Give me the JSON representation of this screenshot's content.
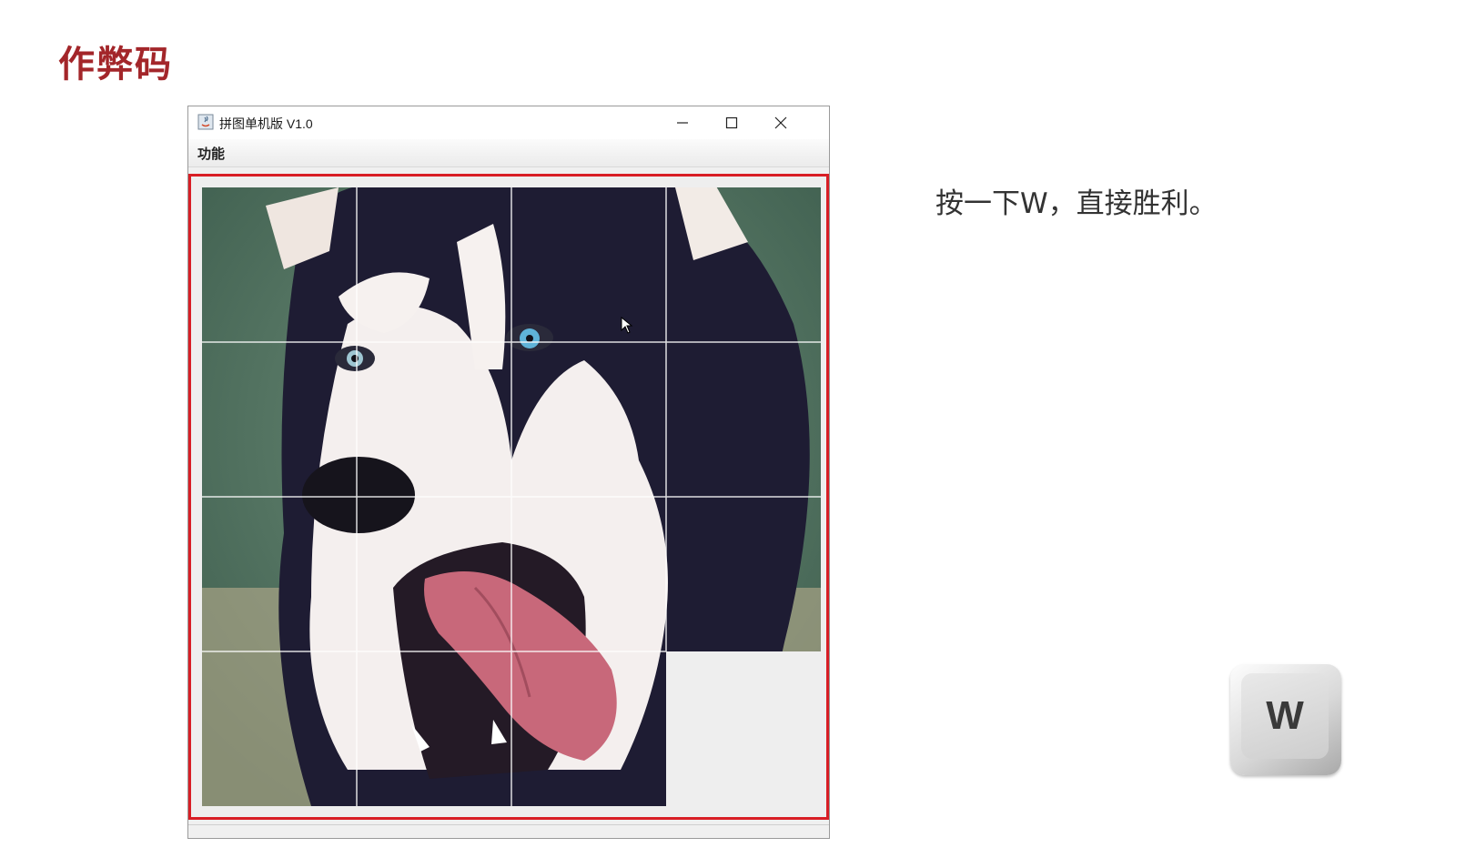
{
  "slide": {
    "title": "作弊码",
    "hint": "按一下W，直接胜利。"
  },
  "window": {
    "title": "拼图单机版 V1.0",
    "menu": [
      "功能"
    ],
    "controls": [
      "minimize-icon",
      "maximize-icon",
      "close-icon"
    ]
  },
  "puzzle": {
    "grid": 4,
    "tiles_filled": 15,
    "empty_tile": {
      "row": 4,
      "col": 4
    },
    "highlight_color": "#d81e25"
  },
  "key": {
    "label": "W"
  }
}
